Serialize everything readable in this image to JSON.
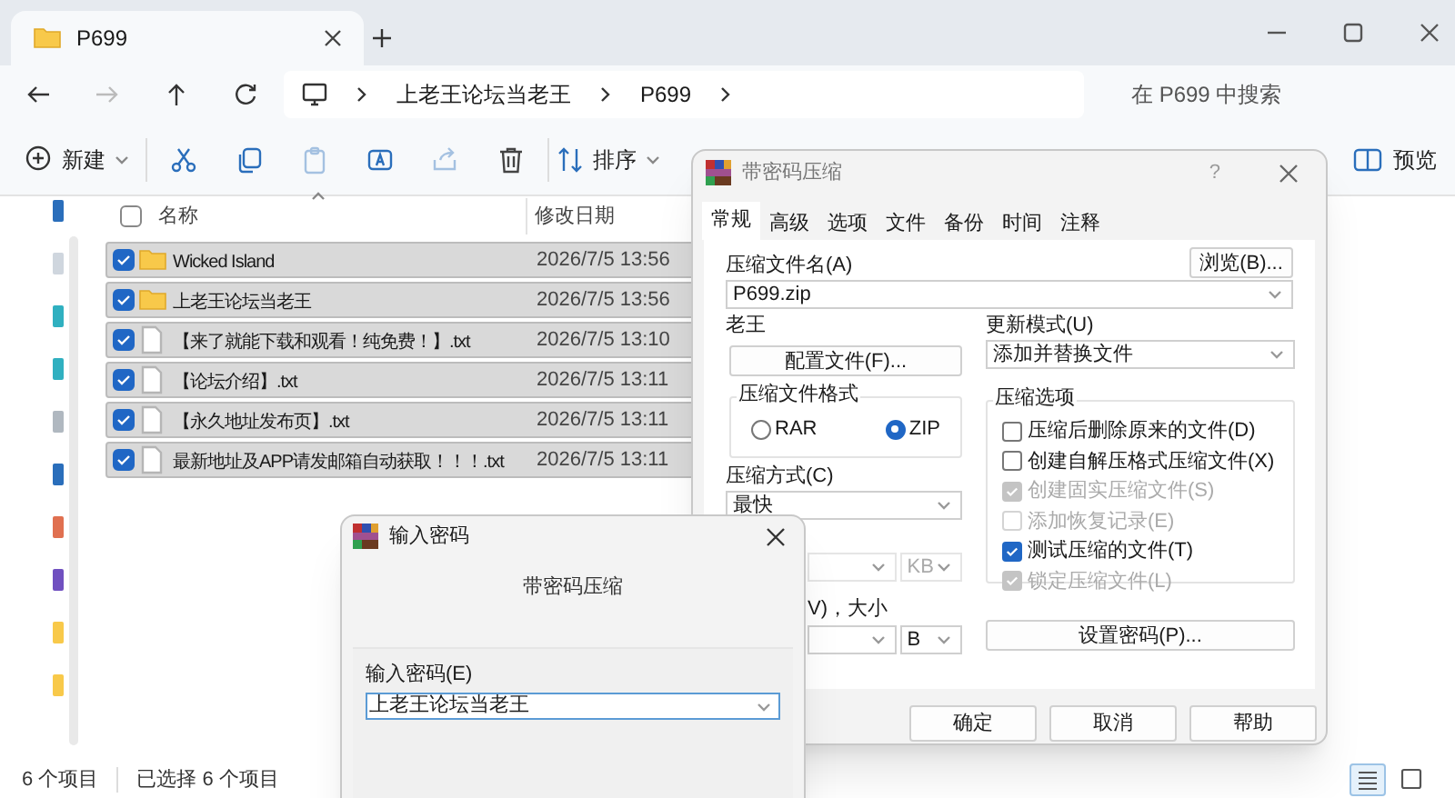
{
  "explorer": {
    "tab_title": "P699",
    "breadcrumb": [
      "上老王论坛当老王",
      "P699"
    ],
    "search": {
      "placeholder": "在 P699 中搜索"
    },
    "toolbar": [
      {
        "kind": "new",
        "label": "新建",
        "disabled": false
      },
      {
        "kind": "cut",
        "disabled": false
      },
      {
        "kind": "copy",
        "disabled": false
      },
      {
        "kind": "paste",
        "disabled": true
      },
      {
        "kind": "rename",
        "disabled": false
      },
      {
        "kind": "share",
        "disabled": true
      },
      {
        "kind": "delete",
        "disabled": false
      },
      {
        "kind": "sort",
        "label": "排序",
        "disabled": false
      }
    ],
    "preview": {
      "label": "预览"
    },
    "columns": [
      "名称",
      "修改日期"
    ],
    "header_checked": false,
    "rows": [
      {
        "kind": "folder",
        "name": "Wicked Island",
        "date": "2026/7/5 13:56",
        "checked": true,
        "selected": true
      },
      {
        "kind": "folder",
        "name": "上老王论坛当老王",
        "date": "2026/7/5 13:56",
        "checked": true,
        "selected": true
      },
      {
        "kind": "file",
        "name": "【来了就能下载和观看！纯免费！】.txt",
        "date": "2026/7/5 13:10",
        "checked": true,
        "selected": true
      },
      {
        "kind": "file",
        "name": "【论坛介绍】.txt",
        "date": "2026/7/5 13:11",
        "checked": true,
        "selected": true
      },
      {
        "kind": "file",
        "name": "【永久地址发布页】.txt",
        "date": "2026/7/5 13:11",
        "checked": true,
        "selected": true
      },
      {
        "kind": "file",
        "name": "最新地址及APP请发邮箱自动获取！！！.txt",
        "date": "2026/7/5 13:11",
        "checked": true,
        "selected": true
      }
    ],
    "status_bar": [
      "6 个项目",
      "已选择 6 个项目"
    ],
    "view_buttons": [
      {
        "kind": "details",
        "selected": true
      },
      {
        "kind": "tiles",
        "selected": false
      }
    ]
  },
  "archive_dialog": {
    "title": "带密码压缩",
    "help": "?",
    "tabs": [
      {
        "label": "常规",
        "selected": true
      },
      {
        "label": "高级",
        "selected": false
      },
      {
        "label": "选项",
        "selected": false
      },
      {
        "label": "文件",
        "selected": false
      },
      {
        "label": "备份",
        "selected": false
      },
      {
        "label": "时间",
        "selected": false
      },
      {
        "label": "注释",
        "selected": false
      }
    ],
    "archive_name_label": "压缩文件名(A)",
    "browse_button": "浏览(B)...",
    "archive_name": "P699.zip",
    "profile_label": "老王",
    "profile_button": "配置文件(F)...",
    "update_mode_label": "更新模式(U)",
    "update_mode": "添加并替换文件",
    "format_group": {
      "title": "压缩文件格式",
      "options": [
        {
          "label": "RAR",
          "selected": false
        },
        {
          "label": "ZIP",
          "selected": true
        }
      ]
    },
    "method_label": "压缩方式(C)",
    "method": "最快",
    "dictionary_unit": "KB",
    "volume_label": "V)，大小",
    "volume_unit": "B",
    "options_group": {
      "title": "压缩选项",
      "options": [
        {
          "label": "压缩后删除原来的文件(D)",
          "checked": false,
          "disabled": false
        },
        {
          "label": "创建自解压格式压缩文件(X)",
          "checked": false,
          "disabled": false
        },
        {
          "label": "创建固实压缩文件(S)",
          "checked": true,
          "disabled": true
        },
        {
          "label": "添加恢复记录(E)",
          "checked": false,
          "disabled": true
        },
        {
          "label": "测试压缩的文件(T)",
          "checked": true,
          "disabled": false
        },
        {
          "label": "锁定压缩文件(L)",
          "checked": true,
          "disabled": true
        }
      ]
    },
    "password_button": "设置密码(P)...",
    "buttons": [
      "确定",
      "取消",
      "帮助"
    ]
  },
  "password_dialog": {
    "title": "输入密码",
    "subtitle": "带密码压缩",
    "field_label": "输入密码(E)",
    "value": "上老王论坛当老王"
  }
}
